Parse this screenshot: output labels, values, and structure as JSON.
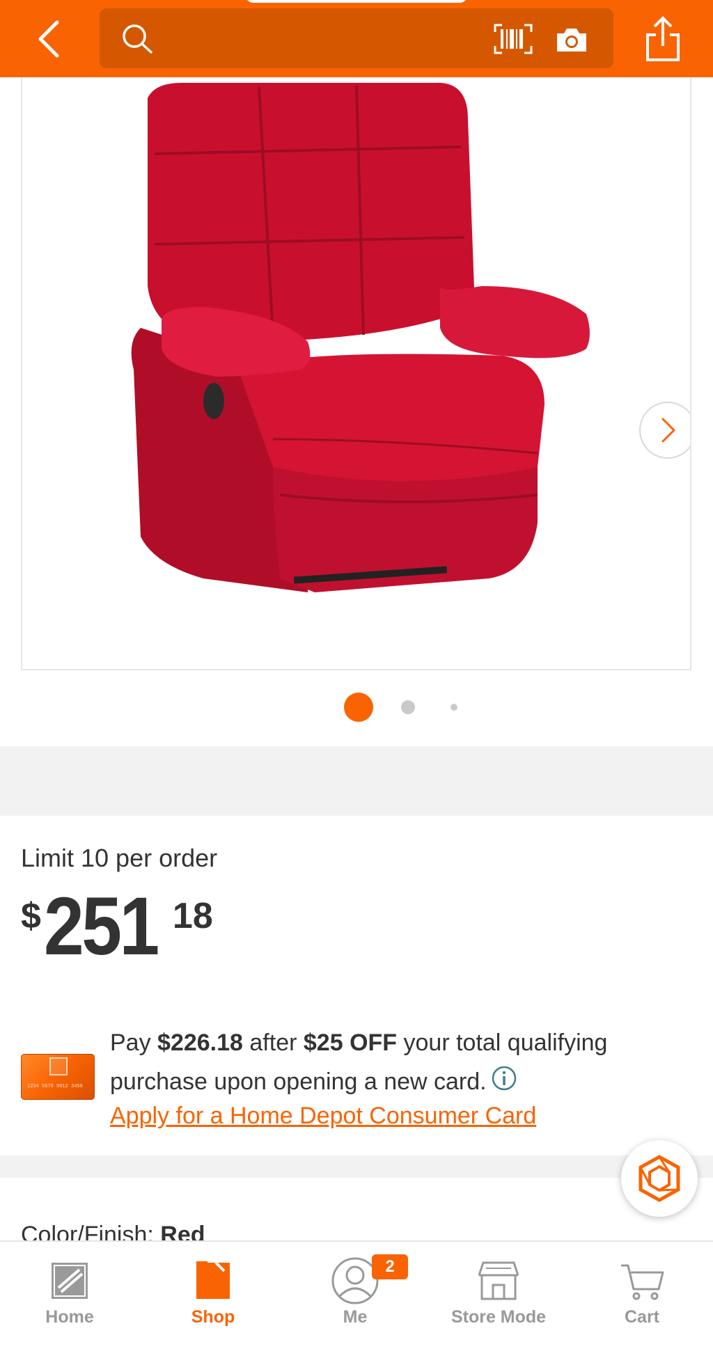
{
  "header": {
    "back_icon": "chevron-left-icon",
    "search_icon": "search-icon",
    "search_placeholder": "",
    "barcode_icon": "barcode-scan-icon",
    "camera_icon": "camera-icon",
    "share_icon": "share-icon",
    "accent_color": "#f96302"
  },
  "gallery": {
    "image_description_icon": "recliner-chair-image",
    "next_icon": "chevron-right-icon",
    "page_count": 3,
    "active_index": 0
  },
  "pricing": {
    "limit_text": "Limit 10 per order",
    "currency": "$",
    "whole": "251",
    "cents": "18"
  },
  "promo": {
    "pay_prefix": "Pay ",
    "pay_amount": "$226.18",
    "after_text": " after ",
    "discount": "$25 OFF",
    "suffix": " your total qualifying purchase upon opening a new card.",
    "info_icon": "info-icon",
    "apply_link": "Apply for a Home Depot Consumer Card",
    "card_number": "1234 5678 9012 3456"
  },
  "options": {
    "color_label": "Color/Finish: ",
    "color_value": "Red"
  },
  "chat": {
    "icon": "chat-assistant-icon"
  },
  "bottom_nav": {
    "items": [
      {
        "label": "Home",
        "icon": "home-depot-logo-icon",
        "active": false
      },
      {
        "label": "Shop",
        "icon": "shop-tag-icon",
        "active": true
      },
      {
        "label": "Me",
        "icon": "user-icon",
        "active": false,
        "badge": "2"
      },
      {
        "label": "Store Mode",
        "icon": "store-icon",
        "active": false
      },
      {
        "label": "Cart",
        "icon": "cart-icon",
        "active": false
      }
    ]
  }
}
